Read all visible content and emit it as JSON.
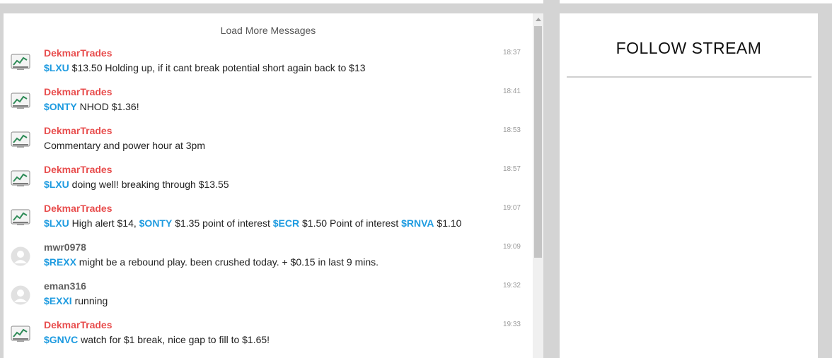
{
  "chat": {
    "load_more": "Load More Messages",
    "messages": [
      {
        "user": "DekmarTrades",
        "time": "18:37",
        "parts": [
          {
            "t": "ticker",
            "v": "$LXU"
          },
          {
            "t": "text",
            "v": " $13.50 Holding up, if it cant break potential short again back to $13"
          }
        ]
      },
      {
        "user": "DekmarTrades",
        "time": "18:41",
        "parts": [
          {
            "t": "ticker",
            "v": "$ONTY"
          },
          {
            "t": "text",
            "v": " NHOD $1.36!"
          }
        ]
      },
      {
        "user": "DekmarTrades",
        "time": "18:53",
        "parts": [
          {
            "t": "text",
            "v": "Commentary and power hour at 3pm"
          }
        ]
      },
      {
        "user": "DekmarTrades",
        "time": "18:57",
        "parts": [
          {
            "t": "ticker",
            "v": "$LXU"
          },
          {
            "t": "text",
            "v": " doing well! breaking through $13.55"
          }
        ]
      },
      {
        "user": "DekmarTrades",
        "time": "19:07",
        "parts": [
          {
            "t": "ticker",
            "v": "$LXU"
          },
          {
            "t": "text",
            "v": " High alert $14, "
          },
          {
            "t": "ticker",
            "v": "$ONTY"
          },
          {
            "t": "text",
            "v": " $1.35 point of interest "
          },
          {
            "t": "ticker",
            "v": "$ECR"
          },
          {
            "t": "text",
            "v": " $1.50 Point of interest "
          },
          {
            "t": "ticker",
            "v": "$RNVA"
          },
          {
            "t": "text",
            "v": " $1.10"
          }
        ]
      },
      {
        "user": "mwr0978",
        "time": "19:09",
        "parts": [
          {
            "t": "ticker",
            "v": "$REXX"
          },
          {
            "t": "text",
            "v": " might be a rebound play. been crushed today. + $0.15 in last 9 mins."
          }
        ]
      },
      {
        "user": "eman316",
        "time": "19:32",
        "parts": [
          {
            "t": "ticker",
            "v": "$EXXI"
          },
          {
            "t": "text",
            "v": " running"
          }
        ]
      },
      {
        "user": "DekmarTrades",
        "time": "19:33",
        "parts": [
          {
            "t": "ticker",
            "v": "$GNVC"
          },
          {
            "t": "text",
            "v": " watch for $1 break, nice gap to fill to $1.65!"
          }
        ]
      }
    ]
  },
  "follow": {
    "title": "FOLLOW STREAM"
  },
  "colors": {
    "trader_name": "#e84e4e",
    "plain_name": "#606060",
    "ticker": "#1e9be0"
  },
  "icons": {
    "trader_avatar": "trend-chart-icon",
    "default_avatar": "default-user-icon"
  }
}
